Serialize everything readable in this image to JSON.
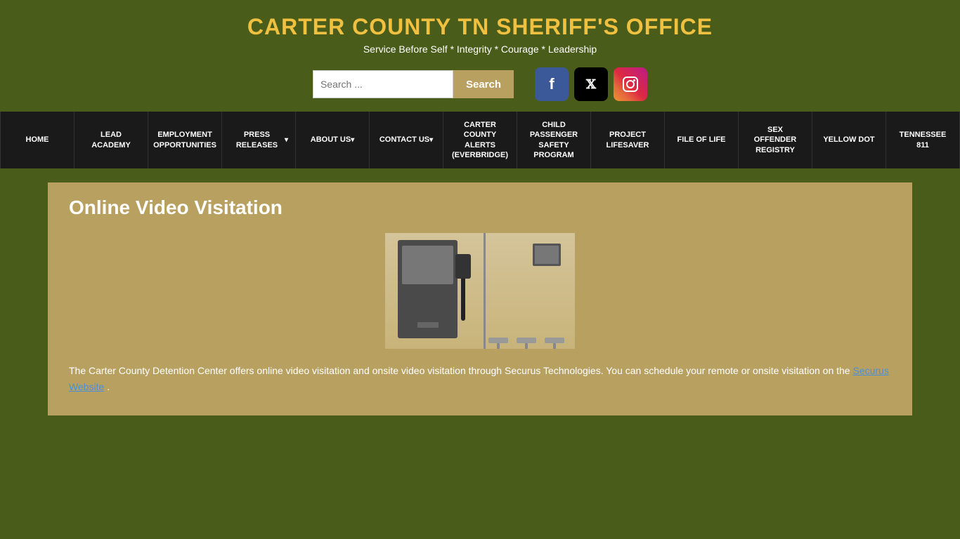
{
  "header": {
    "title": "CARTER COUNTY TN SHERIFF'S OFFICE",
    "subtitle": "Service Before Self * Integrity * Courage * Leadership"
  },
  "search": {
    "placeholder": "Search ...",
    "button_label": "Search"
  },
  "social": {
    "facebook_label": "f",
    "x_label": "𝕏",
    "instagram_label": "📷"
  },
  "nav": {
    "items": [
      {
        "label": "HOME",
        "has_dropdown": false
      },
      {
        "label": "LEAD ACADEMY",
        "has_dropdown": false
      },
      {
        "label": "EMPLOYMENT OPPORTUNITIES",
        "has_dropdown": false
      },
      {
        "label": "PRESS RELEASES",
        "has_dropdown": true
      },
      {
        "label": "ABOUT US",
        "has_dropdown": true
      },
      {
        "label": "CONTACT US",
        "has_dropdown": true
      },
      {
        "label": "CARTER COUNTY ALERTS (EVERBRIDGE)",
        "has_dropdown": false
      },
      {
        "label": "CHILD PASSENGER SAFETY PROGRAM",
        "has_dropdown": false
      },
      {
        "label": "PROJECT LIFESAVER",
        "has_dropdown": false
      },
      {
        "label": "FILE OF LIFE",
        "has_dropdown": false
      },
      {
        "label": "SEX OFFENDER REGISTRY",
        "has_dropdown": false
      },
      {
        "label": "YELLOW DOT",
        "has_dropdown": false
      },
      {
        "label": "TENNESSEE 811",
        "has_dropdown": false
      }
    ]
  },
  "main": {
    "page_title": "Online Video Visitation",
    "description": "The Carter County Detention Center offers online video visitation and onsite video visitation through Securus Technologies. You can schedule your remote or onsite visitation on the ",
    "link_text": "Securus Website",
    "description_end": "."
  }
}
